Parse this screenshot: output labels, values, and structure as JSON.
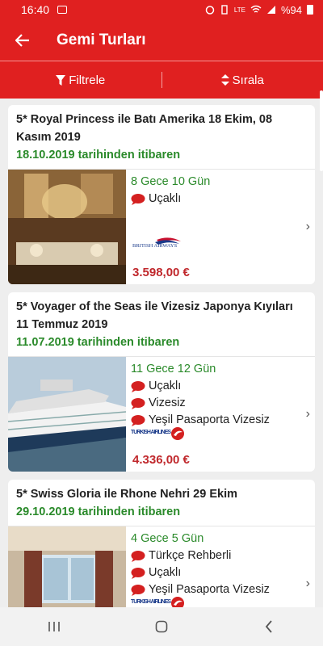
{
  "status": {
    "time": "16:40",
    "battery": "%94",
    "network": "LTE"
  },
  "header": {
    "title": "Gemi Turları"
  },
  "toolbar": {
    "filter_label": "Filtrele",
    "sort_label": "Sırala"
  },
  "colors": {
    "brand": "#e02020",
    "green": "#2a8a2a",
    "price": "#c0282c"
  },
  "tours": [
    {
      "title": "5* Royal Princess ile Batı Amerika 18 Ekim, 08 Kasım 2019",
      "date": "18.10.2019 tarihinden itibaren",
      "duration": "8 Gece 10 Gün",
      "features": [
        "Uçaklı"
      ],
      "airline": "BRITISH AIRWAYS",
      "price": "3.598,00 €"
    },
    {
      "title": "5* Voyager of the Seas ile Vizesiz Japonya Kıyıları 11 Temmuz 2019",
      "date": "11.07.2019 tarihinden itibaren",
      "duration": "11 Gece 12 Gün",
      "features": [
        "Uçaklı",
        "Vizesiz",
        "Yeşil Pasaporta Vizesiz"
      ],
      "airline": "TURKISH AIRLINES",
      "price": "4.336,00 €"
    },
    {
      "title": "5* Swiss Gloria ile Rhone Nehri 29 Ekim",
      "date": "29.10.2019 tarihinden itibaren",
      "duration": "4 Gece 5 Gün",
      "features": [
        "Türkçe Rehberli",
        "Uçaklı",
        "Yeşil Pasaporta Vizesiz"
      ],
      "airline": "TURKISH AIRLINES",
      "price": ""
    }
  ]
}
